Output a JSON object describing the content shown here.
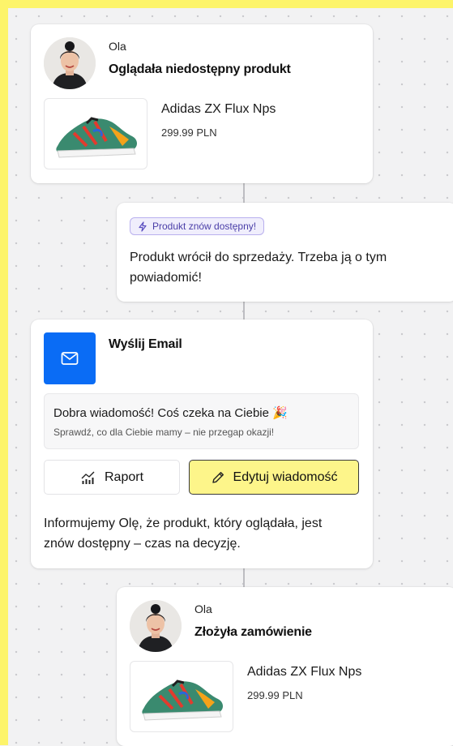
{
  "flow": {
    "step1": {
      "user_name": "Ola",
      "title": "Oglądała niedostępny produkt",
      "product_name": "Adidas ZX Flux Nps",
      "product_price": "299.99 PLN"
    },
    "step2": {
      "badge": "Produkt znów dostępny!",
      "text": "Produkt wrócił do sprzedaży. Trzeba ją o tym powiadomić!"
    },
    "step3": {
      "title": "Wyślij Email",
      "email_subject": "Dobra wiadomość! Coś czeka na Ciebie 🎉",
      "email_preview": "Sprawdź, co dla Ciebie mamy – nie przegap okazji!",
      "report_label": "Raport",
      "edit_label": "Edytuj wiadomość",
      "text": "Informujemy Olę, że produkt, który oglądała, jest znów dostępny – czas na decyzję."
    },
    "step4": {
      "user_name": "Ola",
      "title": "Złożyła zamówienie",
      "product_name": "Adidas ZX Flux Nps",
      "product_price": "299.99 PLN"
    }
  },
  "colors": {
    "frame": "#fdf46a",
    "email_icon_bg": "#0a6cf5",
    "edit_button_bg": "#fdf58a",
    "badge_bg": "#f0eefc",
    "badge_border": "#b9b0ee"
  },
  "icons": {
    "avatar": "user-avatar",
    "product": "sneaker-image",
    "badge": "lightning-icon",
    "email": "envelope-icon",
    "report": "chart-icon",
    "edit": "pencil-icon"
  }
}
